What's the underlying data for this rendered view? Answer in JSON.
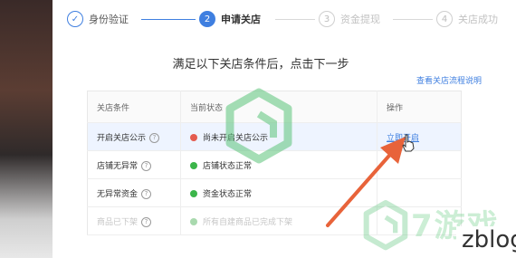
{
  "steps": [
    {
      "num": "✓",
      "label": "身份验证",
      "state": "done"
    },
    {
      "num": "2",
      "label": "申请关店",
      "state": "active"
    },
    {
      "num": "3",
      "label": "资金提现",
      "state": "todo"
    },
    {
      "num": "4",
      "label": "关店成功",
      "state": "todo"
    }
  ],
  "heading": "满足以下关店条件后，点击下一步",
  "help_link": "查看关店流程说明",
  "table": {
    "headers": [
      "关店条件",
      "当前状态",
      "操作"
    ],
    "rows": [
      {
        "condition": "开启关店公示",
        "status": "尚未开启关店公示",
        "status_color": "red",
        "action": "立即开启"
      },
      {
        "condition": "店铺无异常",
        "status": "店铺状态正常",
        "status_color": "green",
        "action": ""
      },
      {
        "condition": "无异常资金",
        "status": "资金状态正常",
        "status_color": "green",
        "action": ""
      },
      {
        "condition": "商品已下架",
        "status": "所有自建商品已完成下架",
        "status_color": "green",
        "action": ""
      }
    ]
  },
  "watermark": {
    "brand": "7游戏",
    "zblog": "zblog"
  },
  "colors": {
    "primary": "#3f7fe0",
    "error": "#e45b4f",
    "success": "#3bb54a",
    "arrow": "#e8633a"
  }
}
